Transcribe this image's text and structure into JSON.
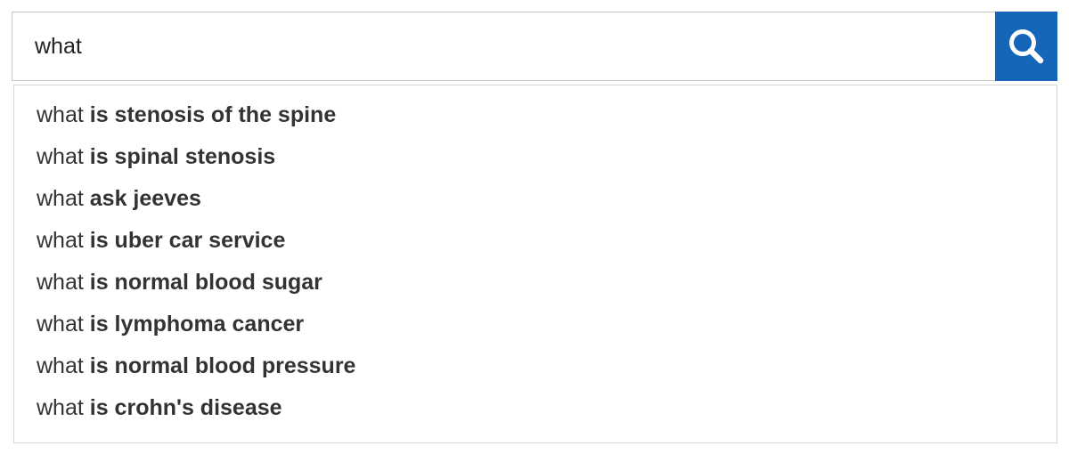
{
  "search": {
    "query": "what",
    "button_icon": "search-icon",
    "button_color": "#1565b8"
  },
  "suggestions": [
    {
      "typed": "what",
      "completion": "is stenosis of the spine"
    },
    {
      "typed": "what",
      "completion": "is spinal stenosis"
    },
    {
      "typed": "what",
      "completion": "ask jeeves"
    },
    {
      "typed": "what",
      "completion": "is uber car service"
    },
    {
      "typed": "what",
      "completion": "is normal blood sugar"
    },
    {
      "typed": "what",
      "completion": "is lymphoma cancer"
    },
    {
      "typed": "what",
      "completion": "is normal blood pressure"
    },
    {
      "typed": "what",
      "completion": "is crohn's disease"
    }
  ]
}
